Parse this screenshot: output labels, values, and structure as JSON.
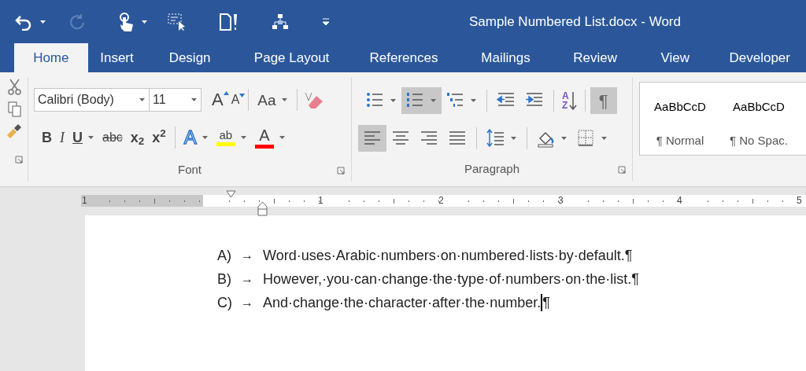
{
  "window": {
    "title": "Sample Numbered List.docx - Word"
  },
  "quick_access": [
    {
      "kind": "undo",
      "disabled": false,
      "dropdown": true
    },
    {
      "kind": "redo",
      "disabled": true,
      "dropdown": false
    },
    {
      "kind": "touch",
      "disabled": false,
      "dropdown": true
    },
    {
      "kind": "select",
      "disabled": false,
      "dropdown": false
    },
    {
      "kind": "page",
      "disabled": false,
      "dropdown": false
    },
    {
      "kind": "tree",
      "disabled": false,
      "dropdown": false
    },
    {
      "kind": "customize",
      "disabled": false,
      "dropdown": false
    }
  ],
  "tabs": [
    {
      "label": "Home",
      "selected": true
    },
    {
      "label": "Insert",
      "selected": false
    },
    {
      "label": "Design",
      "selected": false
    },
    {
      "label": "Page Layout",
      "selected": false
    },
    {
      "label": "References",
      "selected": false
    },
    {
      "label": "Mailings",
      "selected": false
    },
    {
      "label": "Review",
      "selected": false
    },
    {
      "label": "View",
      "selected": false
    },
    {
      "label": "Developer",
      "selected": false
    }
  ],
  "font_group": {
    "label": "Font",
    "font_name": "Calibri (Body)",
    "font_size": "11",
    "row_1": [
      {
        "kind": "grow",
        "glyph": "A"
      },
      {
        "kind": "shrink",
        "glyph": "A"
      },
      {
        "kind": "separator"
      },
      {
        "kind": "case",
        "glyph": "Aa",
        "dropdown": true
      },
      {
        "kind": "separator"
      },
      {
        "kind": "clear"
      }
    ],
    "row_2": [
      {
        "kind": "bold",
        "glyph": "B"
      },
      {
        "kind": "italic",
        "glyph": "I"
      },
      {
        "kind": "underline",
        "glyph": "U",
        "dropdown": true
      },
      {
        "kind": "strike",
        "glyph": "abc"
      },
      {
        "kind": "script",
        "glyph": "x$_{2}$"
      },
      {
        "kind": "script",
        "glyph": "x$^{2}$"
      },
      {
        "kind": "separator"
      },
      {
        "kind": "effects",
        "glyph": "A",
        "dropdown": true
      },
      {
        "kind": "highlight",
        "glyph": "ab",
        "color": "#ffff00",
        "dropdown": true
      },
      {
        "kind": "fontcolor",
        "glyph": "A",
        "color": "#ff0000",
        "dropdown": true
      }
    ]
  },
  "paragraph_group": {
    "label": "Paragraph",
    "row_1": [
      {
        "kind": "bullets",
        "selected": false,
        "dropdown": true
      },
      {
        "kind": "numbering",
        "selected": true,
        "dropdown": true
      },
      {
        "kind": "multilevel",
        "selected": false,
        "dropdown": true
      },
      {
        "kind": "separator"
      },
      {
        "kind": "outdent",
        "selected": false
      },
      {
        "kind": "indent",
        "selected": false
      },
      {
        "kind": "separator"
      },
      {
        "kind": "sort",
        "glyph": "AZ",
        "selected": false
      },
      {
        "kind": "separator"
      },
      {
        "kind": "pilcrow",
        "glyph": "¶",
        "selected": true
      }
    ],
    "row_2": [
      {
        "kind": "left",
        "selected": true
      },
      {
        "kind": "center",
        "selected": false
      },
      {
        "kind": "right",
        "selected": false
      },
      {
        "kind": "justify",
        "selected": false
      },
      {
        "kind": "separator"
      },
      {
        "kind": "spacing",
        "selected": false,
        "dropdown": true
      },
      {
        "kind": "separator"
      },
      {
        "kind": "shading",
        "selected": false,
        "dropdown": true
      },
      {
        "kind": "borders",
        "selected": false,
        "dropdown": true
      }
    ]
  },
  "styles": [
    {
      "preview": "AaBbCcD",
      "name": "¶ Normal"
    },
    {
      "preview": "AaBbCcD",
      "name": "¶ No Spac."
    }
  ],
  "ruler": {
    "numbers": [
      "1",
      "1",
      "2",
      "3",
      "4",
      "5"
    ]
  },
  "document": {
    "items": [
      {
        "label": "A)",
        "tab": "→",
        "text": "Word·uses·Arabic·numbers·on·numbered·lists·by·default.",
        "mark": "¶",
        "cursor": false
      },
      {
        "label": "B)",
        "tab": "→",
        "text": "However,·you·can·change·the·type·of·numbers·on·the·list.",
        "mark": "¶",
        "cursor": false
      },
      {
        "label": "C)",
        "tab": "→",
        "text": "And·change·the·character·after·the·number.",
        "mark": "¶",
        "cursor": true
      }
    ]
  }
}
